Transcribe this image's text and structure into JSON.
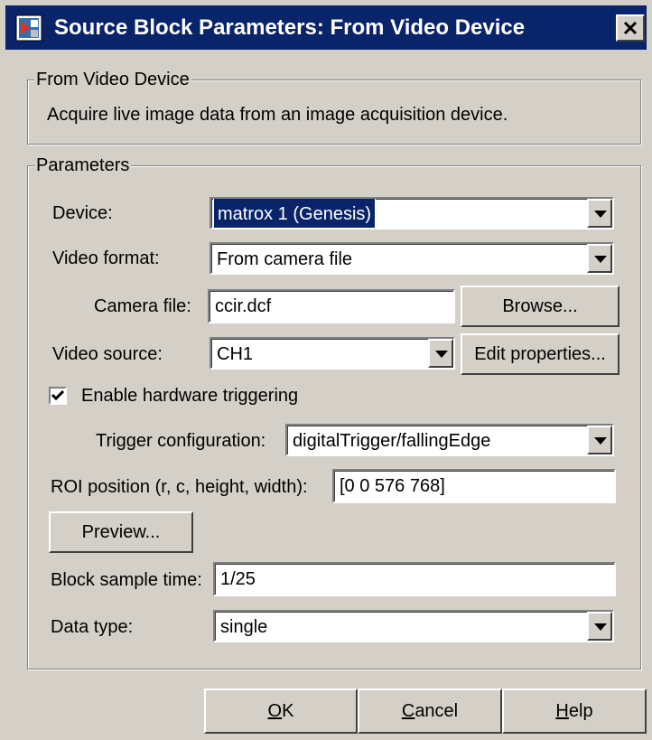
{
  "window": {
    "title": "Source Block Parameters: From Video Device",
    "close_glyph": "✕"
  },
  "description_group": {
    "title": "From Video Device",
    "text": "Acquire live image data from an image acquisition device."
  },
  "parameters": {
    "title": "Parameters",
    "device": {
      "label": "Device:",
      "value": "matrox 1 (Genesis)"
    },
    "video_format": {
      "label": "Video format:",
      "value": "From camera file"
    },
    "camera_file": {
      "label": "Camera file:",
      "value": "ccir.dcf",
      "browse_label": "Browse..."
    },
    "video_source": {
      "label": "Video source:",
      "value": "CH1",
      "edit_label": "Edit properties..."
    },
    "hardware_triggering": {
      "label": "Enable hardware triggering",
      "checked": true
    },
    "trigger_config": {
      "label": "Trigger configuration:",
      "value": "digitalTrigger/fallingEdge"
    },
    "roi": {
      "label": "ROI position (r, c, height, width):",
      "value": "[0 0 576 768]"
    },
    "preview_label": "Preview...",
    "sample_time": {
      "label": "Block sample time:",
      "value": "1/25"
    },
    "data_type": {
      "label": "Data type:",
      "value": "single"
    }
  },
  "footer": {
    "ok": {
      "mnemonic": "O",
      "rest": "K"
    },
    "cancel": {
      "mnemonic": "C",
      "rest": "ancel"
    },
    "help": {
      "mnemonic": "H",
      "rest": "elp"
    }
  },
  "colors": {
    "titlebar": "#0a246a",
    "face": "#d4d0c8"
  }
}
